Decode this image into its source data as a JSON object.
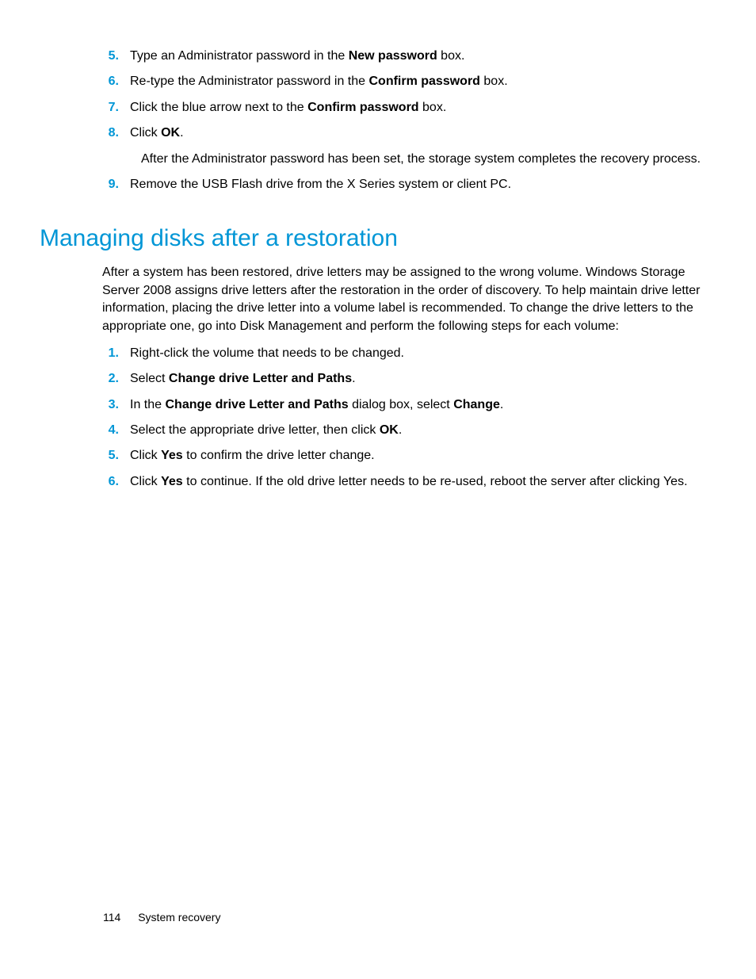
{
  "list1": {
    "items": [
      {
        "num": "5.",
        "pre": "Type an Administrator password in the ",
        "b1": "New password",
        "post": " box."
      },
      {
        "num": "6.",
        "pre": "Re-type the Administrator password in the ",
        "b1": "Confirm password",
        "post": " box."
      },
      {
        "num": "7.",
        "pre": "Click the blue arrow next to the ",
        "b1": "Confirm password",
        "post": " box."
      },
      {
        "num": "8.",
        "pre": "Click ",
        "b1": "OK",
        "post": ".",
        "sub": "After the Administrator password has been set, the storage system completes the recovery process."
      },
      {
        "num": "9.",
        "pre": "Remove the USB Flash drive from the X Series system or client PC."
      }
    ]
  },
  "heading": "Managing disks after a restoration",
  "paragraph": "After a system has been restored, drive letters may be assigned to the wrong volume. Windows Storage Server 2008 assigns drive letters after the restoration in the order of discovery. To help maintain drive letter information, placing the drive letter into a volume label is recommended. To change the drive letters to the appropriate one, go into Disk Management and perform the following steps for each volume:",
  "list2": {
    "items": [
      {
        "num": "1.",
        "pre": "Right-click the volume that needs to be changed."
      },
      {
        "num": "2.",
        "pre": "Select ",
        "b1": "Change drive Letter and Paths",
        "post": "."
      },
      {
        "num": "3.",
        "pre": "In the ",
        "b1": "Change drive Letter and Paths",
        "mid1": " dialog box, select ",
        "b2": "Change",
        "post": "."
      },
      {
        "num": "4.",
        "pre": "Select the appropriate drive letter, then click ",
        "b1": "OK",
        "post": "."
      },
      {
        "num": "5.",
        "pre": "Click ",
        "b1": "Yes",
        "post": " to confirm the drive letter change."
      },
      {
        "num": "6.",
        "pre": "Click ",
        "b1": "Yes",
        "post": " to continue. If the old drive letter needs to be re-used, reboot the server after clicking Yes."
      }
    ]
  },
  "footer": {
    "page": "114",
    "section": "System recovery"
  }
}
